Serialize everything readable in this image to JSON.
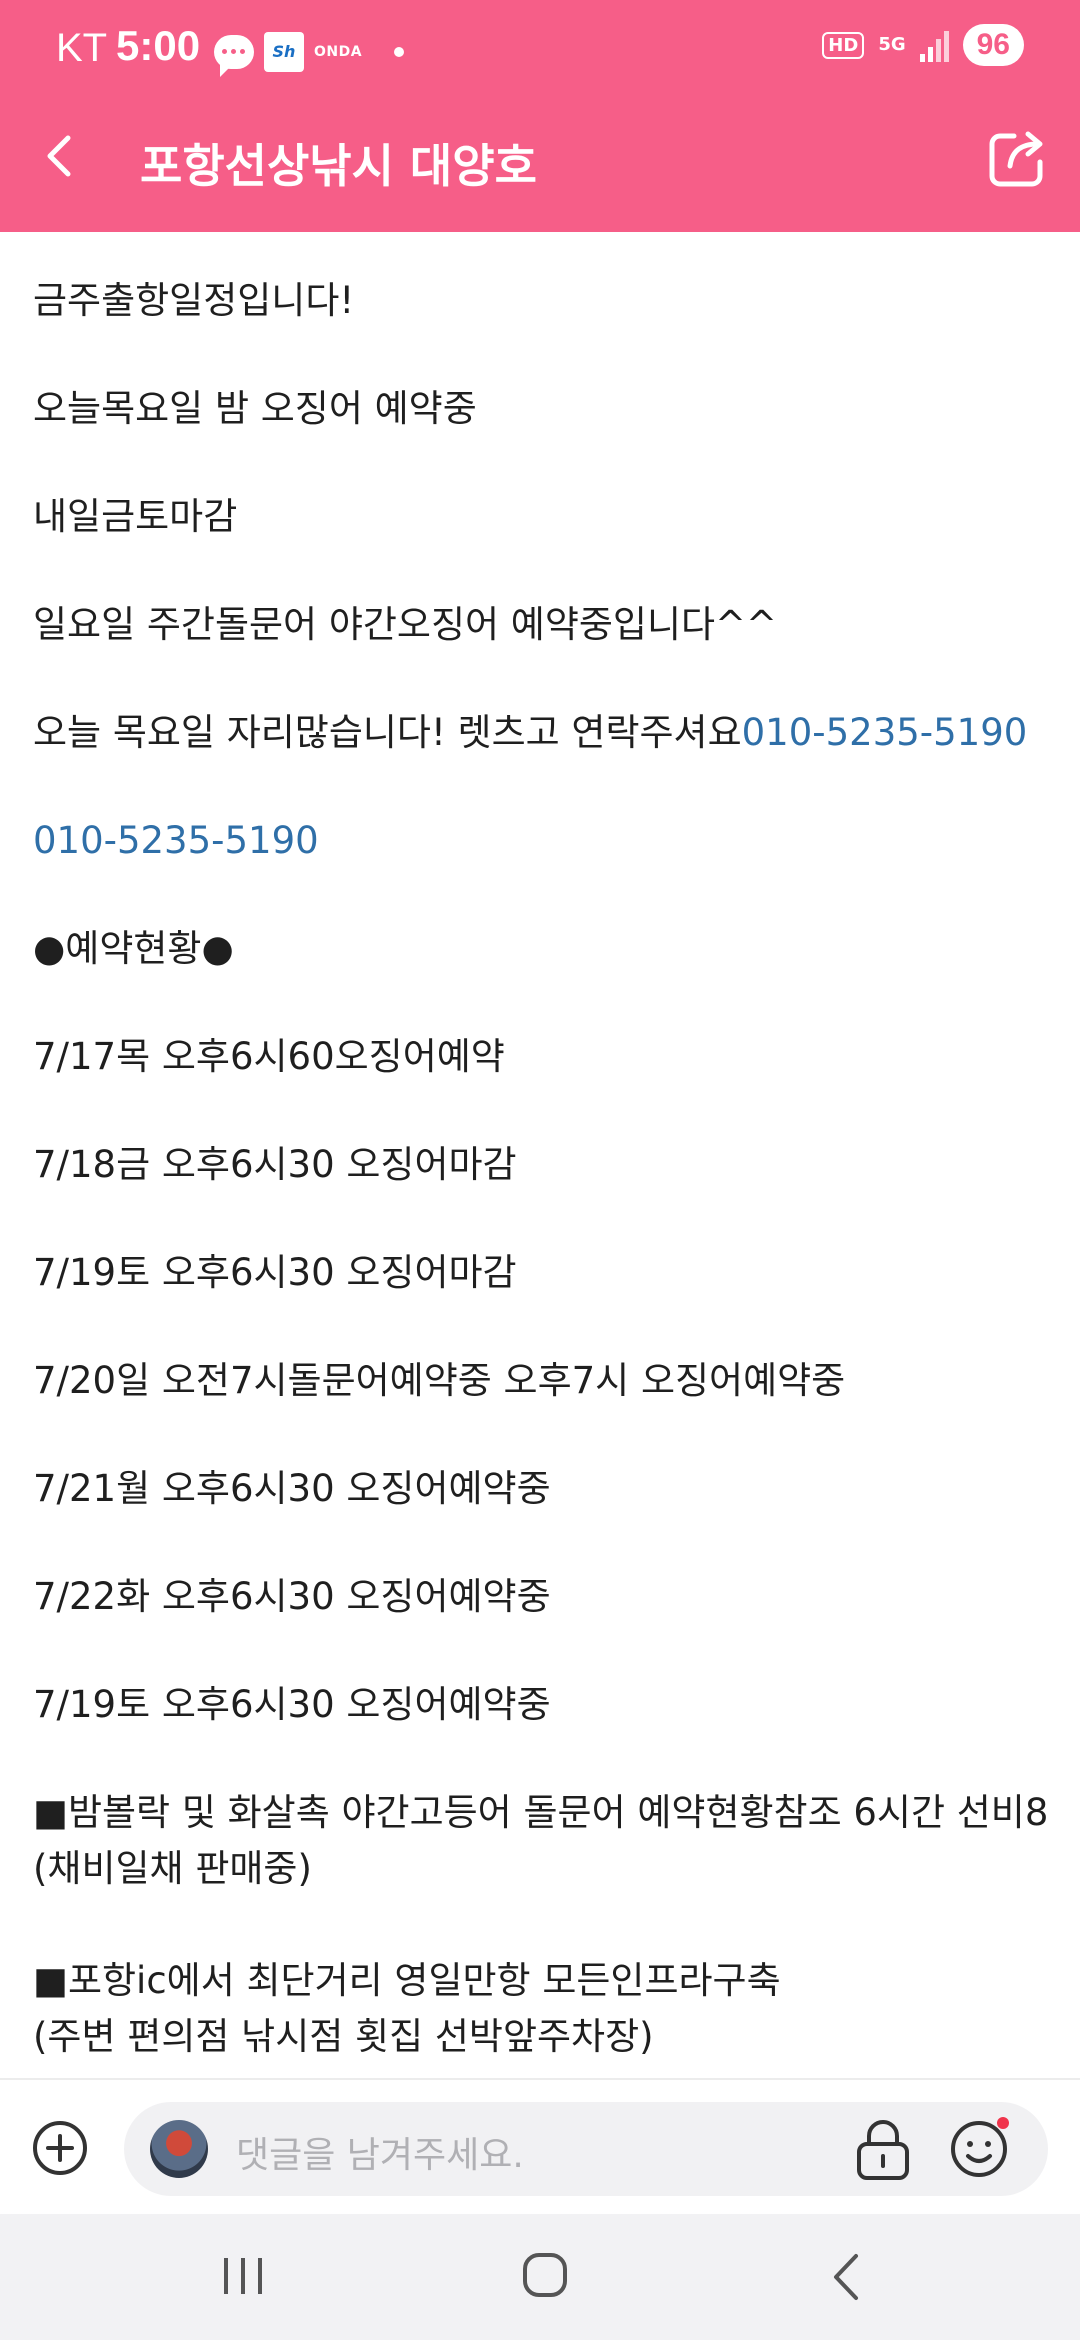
{
  "status_bar": {
    "carrier": "KT",
    "time": "5:00",
    "app_icon_sh": "Sh",
    "app_icon_onda": "ONDA",
    "network_hd": "HD",
    "network_5g": "5G",
    "battery": "96"
  },
  "header": {
    "title": "포항선상낚시 대양호",
    "accent_color": "#f65e88"
  },
  "post": {
    "lines": [
      {
        "text": "금주출항일정입니다!"
      },
      {
        "text": "오늘목요일 밤 오징어 예약중"
      },
      {
        "text": "내일금토마감"
      },
      {
        "text": "일요일 주간돌문어 야간오징어 예약중입니다^^"
      },
      {
        "text": "오늘 목요일 자리많습니다! 렛츠고 연락주셔요",
        "phone": "010-5235-5190"
      },
      {
        "phone": "010-5235-5190"
      },
      {
        "text": "●예약현황●"
      },
      {
        "text": "7/17목 오후6시60오징어예약"
      },
      {
        "text": "7/18금 오후6시30 오징어마감"
      },
      {
        "text": "7/19토 오후6시30 오징어마감"
      },
      {
        "text": "7/20일 오전7시돌문어예약중 오후7시 오징어예약중"
      },
      {
        "text": "7/21월 오후6시30 오징어예약중"
      },
      {
        "text": "7/22화 오후6시30 오징어예약중"
      },
      {
        "text": "7/19토 오후6시30 오징어예약중"
      },
      {
        "text": "■밤볼락 및 화살촉 야간고등어 돌문어 예약현황참조 6시간 선비8"
      },
      {
        "text": "(채비일채 판매중)"
      },
      {
        "text": "■포항ic에서 최단거리 영일만항 모든인프라구축"
      },
      {
        "text": "(주변 편의점 낚시점 횟집 선박앞주차장)"
      }
    ],
    "link_color": "#2f6fa8"
  },
  "comment_bar": {
    "placeholder": "댓글을 남겨주세요."
  }
}
